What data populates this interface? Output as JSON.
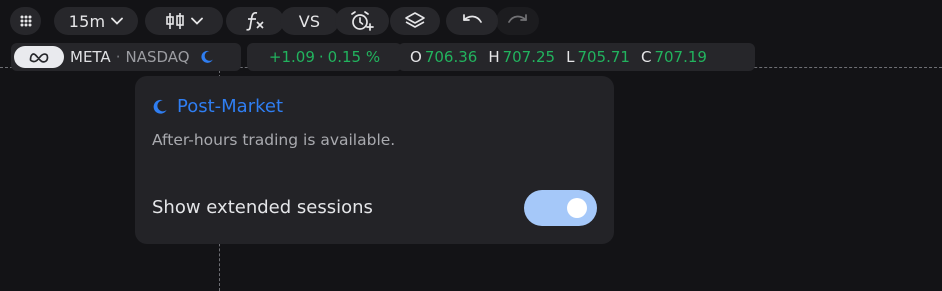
{
  "toolbar": {
    "timeframe": "15m",
    "compare_label": "VS"
  },
  "legend": {
    "symbol": "META",
    "exchange": "NASDAQ",
    "separator": "·",
    "change": "+1.09",
    "change_sep": "·",
    "change_pct": "0.15 %",
    "open_key": "O",
    "open": "706.36",
    "high_key": "H",
    "high": "707.25",
    "low_key": "L",
    "low": "705.71",
    "close_key": "C",
    "close": "707.19"
  },
  "popover": {
    "title": "Post-Market",
    "description": "After-hours trading is available.",
    "toggle_label": "Show extended sessions",
    "toggle_on": true
  },
  "colors": {
    "background": "#131316",
    "up": "#22b35e",
    "accent": "#2f7ef2",
    "toggle_track": "#a5c8f9"
  }
}
